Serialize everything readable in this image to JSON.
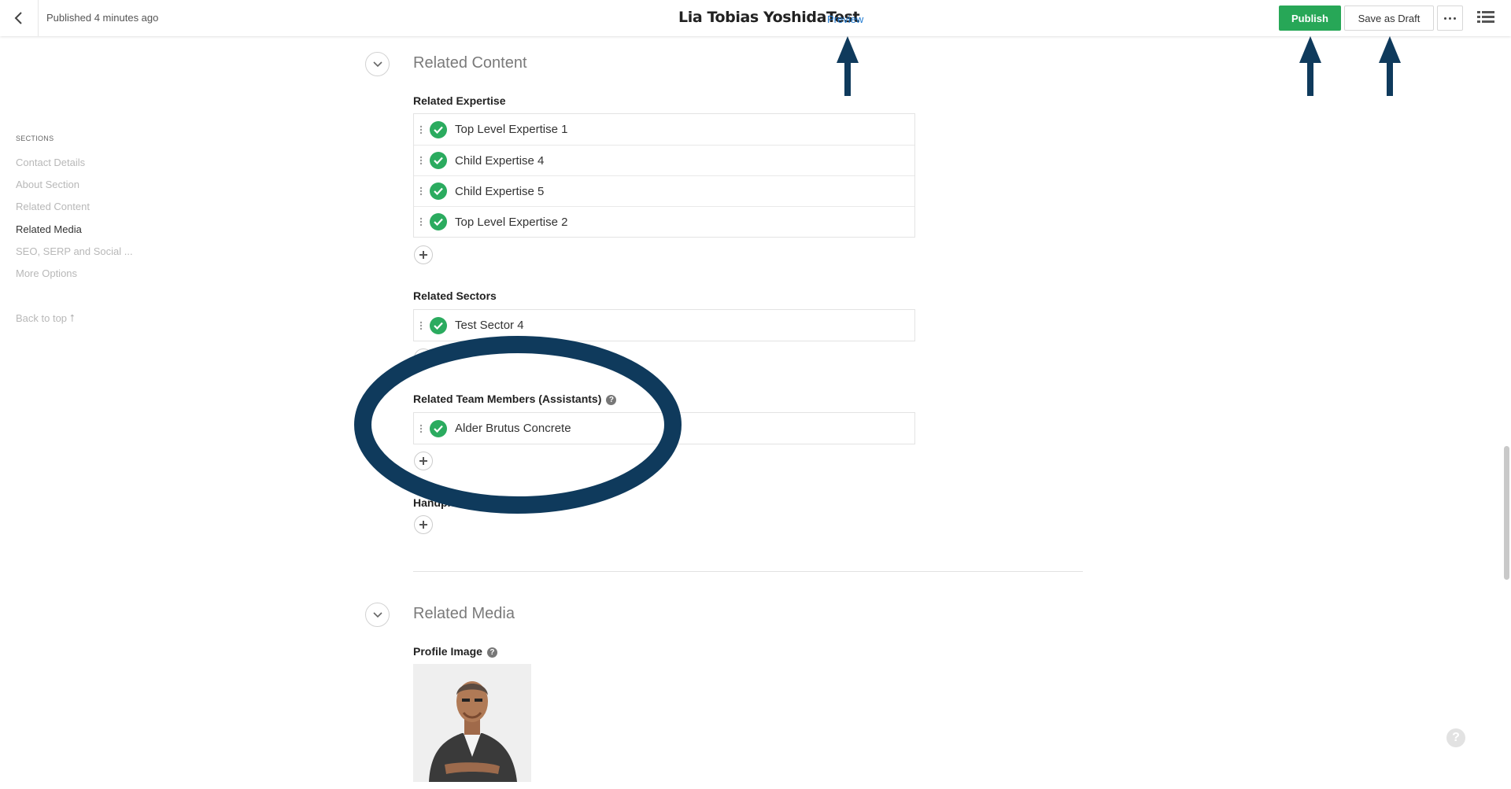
{
  "header": {
    "back_icon": "chevron-left-icon",
    "status": "Published 4 minutes ago",
    "title": "Lia Tobias YoshidaTest",
    "preview": "Preview",
    "publish": "Publish",
    "save_draft": "Save as Draft",
    "more_icon": "ellipsis-icon",
    "list_icon": "list-view-icon",
    "publish_color": "#27a757",
    "link_color": "#1f7ad1"
  },
  "sidebar": {
    "heading": "SECTIONS",
    "items": [
      {
        "label": "Contact Details",
        "active": false
      },
      {
        "label": "About Section",
        "active": false
      },
      {
        "label": "Related Content",
        "active": false
      },
      {
        "label": "Related Media",
        "active": true
      },
      {
        "label": "SEO, SERP and Social ...",
        "active": false
      },
      {
        "label": "More Options",
        "active": false
      }
    ],
    "back_to_top": "Back to top ⭡"
  },
  "related_content": {
    "title": "Related Content",
    "expertise": {
      "label": "Related Expertise",
      "items": [
        "Top Level Expertise 1",
        "Child Expertise 4",
        "Child Expertise 5",
        "Top Level Expertise 2"
      ]
    },
    "sectors": {
      "label": "Related Sectors",
      "items": [
        "Test Sector 4"
      ]
    },
    "team_members": {
      "label": "Related Team Members (Assistants)",
      "items": [
        "Alder Brutus Concrete"
      ]
    },
    "handpicked": {
      "label": "Handpicked Related Cases"
    }
  },
  "related_media": {
    "title": "Related Media",
    "profile_image_label": "Profile Image"
  },
  "annotation": {
    "color": "#0f3a5c"
  },
  "status_colors": {
    "check": "#2bab5f"
  }
}
